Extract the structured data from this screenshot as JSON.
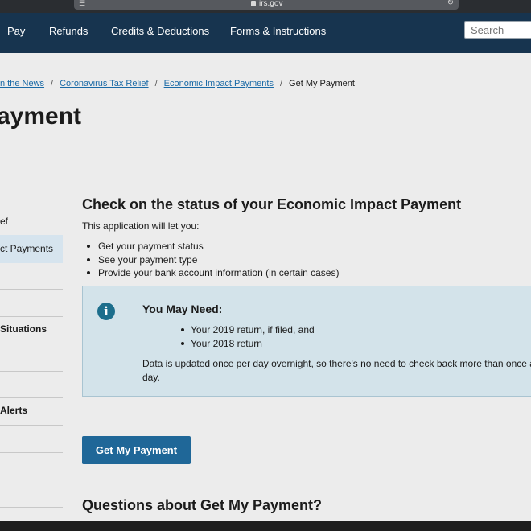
{
  "browser": {
    "url": "irs.gov"
  },
  "nav": {
    "items": [
      "Pay",
      "Refunds",
      "Credits & Deductions",
      "Forms & Instructions"
    ],
    "search_placeholder": "Search"
  },
  "breadcrumb": {
    "items": [
      "n the News",
      "Coronavirus Tax Relief",
      "Economic Impact Payments"
    ],
    "current": "Get My Payment"
  },
  "page": {
    "title": "ayment"
  },
  "sidebar": {
    "items": [
      "ef",
      "ct Payments",
      "Situations",
      "Alerts"
    ]
  },
  "main": {
    "title": "Check on the status of your Economic Impact Payment",
    "intro": "This application will let you:",
    "bullets": [
      "Get your payment status",
      "See your payment type",
      "Provide your bank account information (in certain cases)"
    ]
  },
  "notice": {
    "icon": "info-icon",
    "title": "You May Need:",
    "items": [
      "Your 2019 return, if filed, and",
      "Your 2018 return"
    ],
    "note": "Data is updated once per day overnight, so there's no need to check back more than once a day."
  },
  "cta": {
    "label": "Get My Payment"
  },
  "questions": {
    "title": "Questions about Get My Payment?"
  },
  "colors": {
    "nav_bg": "#17344f",
    "link": "#1a6aa6",
    "button": "#1f6798",
    "notice_bg": "#d3e3ea"
  }
}
